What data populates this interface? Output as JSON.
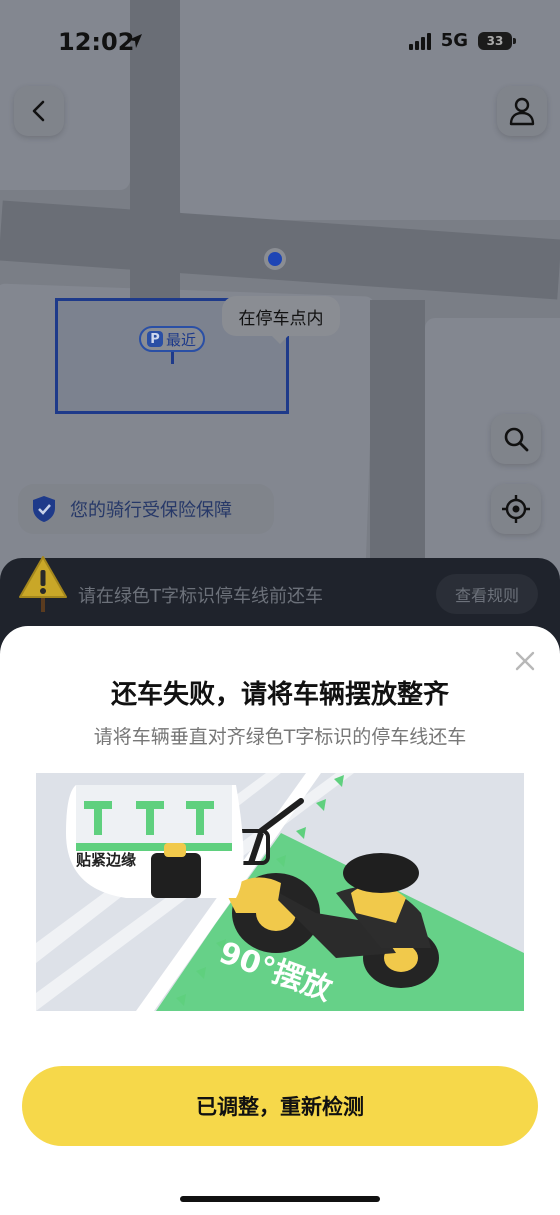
{
  "status_bar": {
    "time": "12:02",
    "network": "5G",
    "battery": "33"
  },
  "map": {
    "tooltip": "在停车点内",
    "parking_badge_letter": "P",
    "parking_badge_text": "最近",
    "insurance_text": "您的骑行受保险保障"
  },
  "warning_bar": {
    "text": "请在绿色T字标识停车线前还车",
    "rules_button": "查看规则"
  },
  "sheet": {
    "title": "还车失败，请将车辆摆放整齐",
    "subtitle": "请将车辆垂直对齐绿色T字标识的停车线还车",
    "illustration": {
      "inset_label": "贴紧边缘",
      "angle_label": "90°摆放"
    },
    "primary_button": "已调整，重新检测"
  },
  "colors": {
    "accent_yellow": "#f6d84a",
    "parking_green": "#5fd07e",
    "map_blue": "#1e3a8a"
  }
}
